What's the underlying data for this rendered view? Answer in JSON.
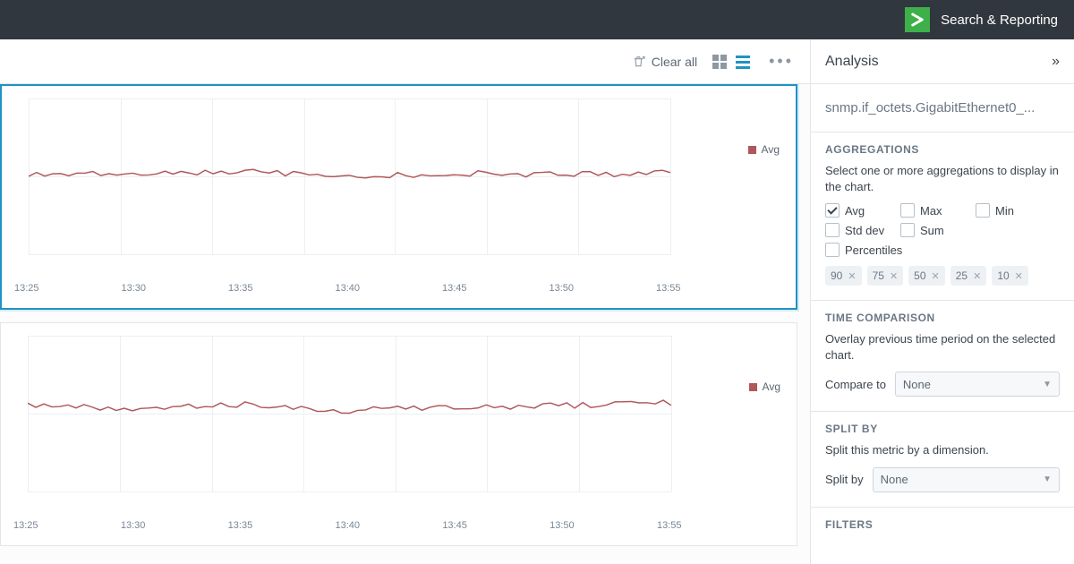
{
  "topbar": {
    "title": "Search & Reporting"
  },
  "toolbar": {
    "clear_all": "Clear all"
  },
  "panel": {
    "title": "Analysis",
    "metric_name": "snmp.if_octets.GigabitEthernet0_..."
  },
  "aggregations": {
    "heading": "AGGREGATIONS",
    "desc": "Select one or more aggregations to display in the chart.",
    "options": {
      "avg": "Avg",
      "max": "Max",
      "min": "Min",
      "stddev": "Std dev",
      "sum": "Sum",
      "percentiles": "Percentiles"
    },
    "percentile_chips": [
      "90",
      "75",
      "50",
      "25",
      "10"
    ]
  },
  "time_comparison": {
    "heading": "TIME COMPARISON",
    "desc": "Overlay previous time period on the selected chart.",
    "label": "Compare to",
    "value": "None"
  },
  "split_by": {
    "heading": "SPLIT BY",
    "desc": "Split this metric by a dimension.",
    "label": "Split by",
    "value": "None"
  },
  "filters": {
    "heading": "FILTERS"
  },
  "chart_legend": "Avg",
  "x_ticks": [
    "13:25",
    "13:30",
    "13:35",
    "13:40",
    "13:45",
    "13:50",
    "13:55"
  ],
  "chart_data": [
    {
      "type": "line",
      "title": "",
      "xlabel": "",
      "ylabel": "",
      "series": [
        {
          "name": "Avg",
          "color": "#af575a",
          "x": [
            "13:25",
            "13:30",
            "13:35",
            "13:40",
            "13:45",
            "13:50",
            "13:55"
          ],
          "values": [
            0.52,
            0.51,
            0.53,
            0.5,
            0.52,
            0.51,
            0.52
          ]
        }
      ],
      "ylim": [
        0,
        1
      ]
    },
    {
      "type": "line",
      "title": "",
      "xlabel": "",
      "ylabel": "",
      "series": [
        {
          "name": "Avg",
          "color": "#af575a",
          "x": [
            "13:25",
            "13:30",
            "13:35",
            "13:40",
            "13:45",
            "13:50",
            "13:55"
          ],
          "values": [
            0.55,
            0.53,
            0.56,
            0.52,
            0.54,
            0.55,
            0.57
          ]
        }
      ],
      "ylim": [
        0,
        1
      ]
    }
  ]
}
